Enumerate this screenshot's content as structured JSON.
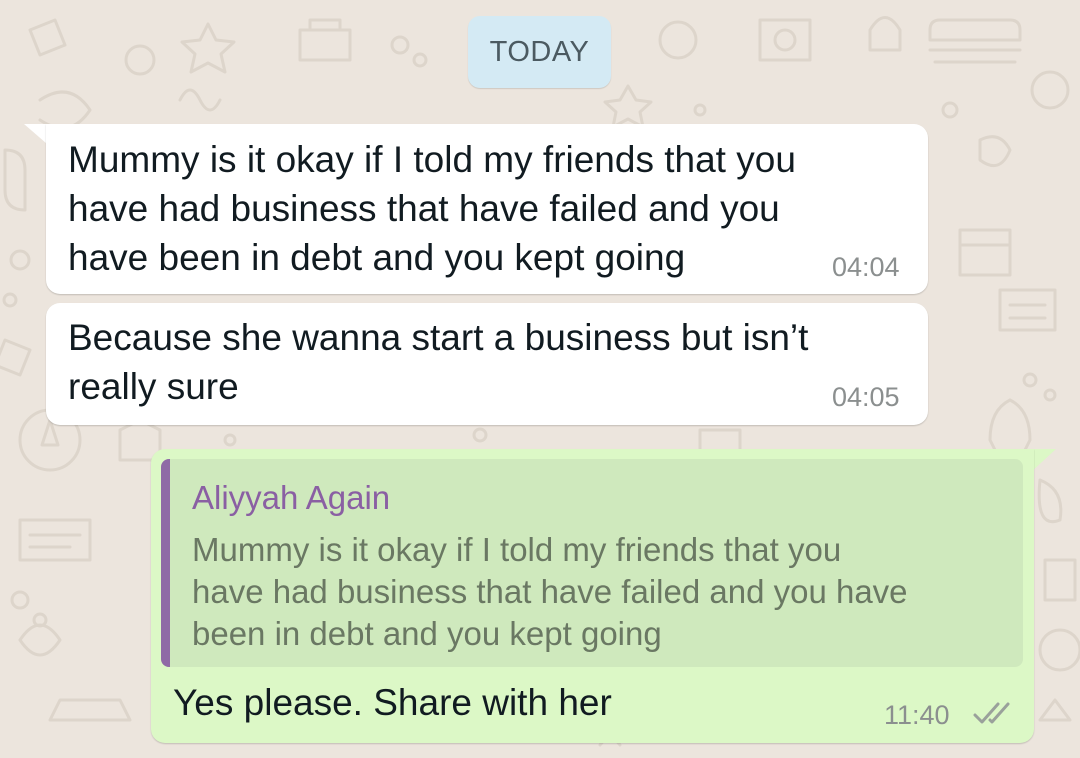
{
  "chat": {
    "date_chip": "TODAY",
    "messages": [
      {
        "direction": "incoming",
        "text": "Mummy is it okay if I told my friends that you\nhave had business that have failed and you\nhave been in debt and you kept going",
        "time": "04:04"
      },
      {
        "direction": "incoming",
        "text": "Because she wanna start a business but isn’t\nreally sure",
        "time": "04:05"
      },
      {
        "direction": "outgoing",
        "reply_to": {
          "author": "Aliyyah Again",
          "text": "Mummy is it okay if I told my friends that you\nhave had business that have failed and you have\nbeen in debt and you kept going"
        },
        "text": "Yes please. Share with her",
        "time": "11:40",
        "status_icon": "double-check-icon"
      }
    ]
  },
  "colors": {
    "wallpaper": "#ece5dd",
    "incoming_bubble": "#ffffff",
    "outgoing_bubble": "#dcf8c6",
    "quote_accent": "#8f6aa6",
    "date_chip": "#d4eaf4"
  }
}
